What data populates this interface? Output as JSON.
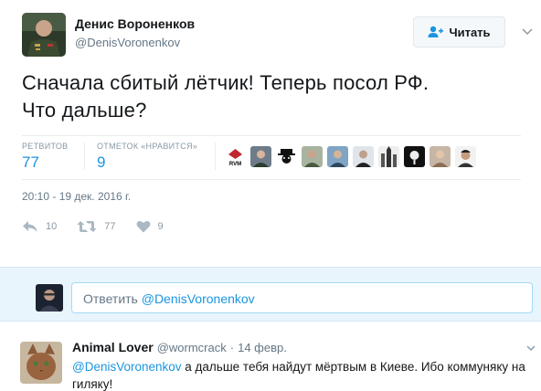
{
  "author": {
    "name": "Денис Вороненков",
    "handle": "@DenisVoronenkov"
  },
  "follow_button": {
    "label": "Читать"
  },
  "tweet": {
    "text_line1": "Сначала сбитый лётчик! Теперь посол РФ.",
    "text_line2": "Что дальше?",
    "timestamp": "20:10 - 19 дек. 2016 г."
  },
  "stats": {
    "retweets_label": "РЕТВИТОВ",
    "retweets_value": "77",
    "likes_label": "ОТМЕТОК «НРАВИТСЯ»",
    "likes_value": "9"
  },
  "likers": [
    {
      "icon": "rvm-logo-avatar"
    },
    {
      "icon": "person-avatar"
    },
    {
      "icon": "hat-avatar"
    },
    {
      "icon": "person-avatar"
    },
    {
      "icon": "person-avatar"
    },
    {
      "icon": "person-avatar"
    },
    {
      "icon": "castle-avatar"
    },
    {
      "icon": "dark-avatar"
    },
    {
      "icon": "person-avatar"
    },
    {
      "icon": "person-avatar"
    }
  ],
  "actions": {
    "reply_count": "10",
    "retweet_count": "77",
    "like_count": "9"
  },
  "reply_box": {
    "prefix": "Ответить ",
    "mention": "@DenisVoronenkov"
  },
  "reply_tweet": {
    "name": "Animal Lover",
    "handle": "@wormcrack",
    "dot": "·",
    "date": "14 февр.",
    "mention": "@DenisVoronenkov",
    "text": " а дальше тебя найдут мёртвым в Киеве. Ибо коммуняку на гиляку!"
  },
  "colors": {
    "accent": "#1b95e0",
    "muted": "#657786",
    "reply_bg": "#e8f5fd"
  }
}
